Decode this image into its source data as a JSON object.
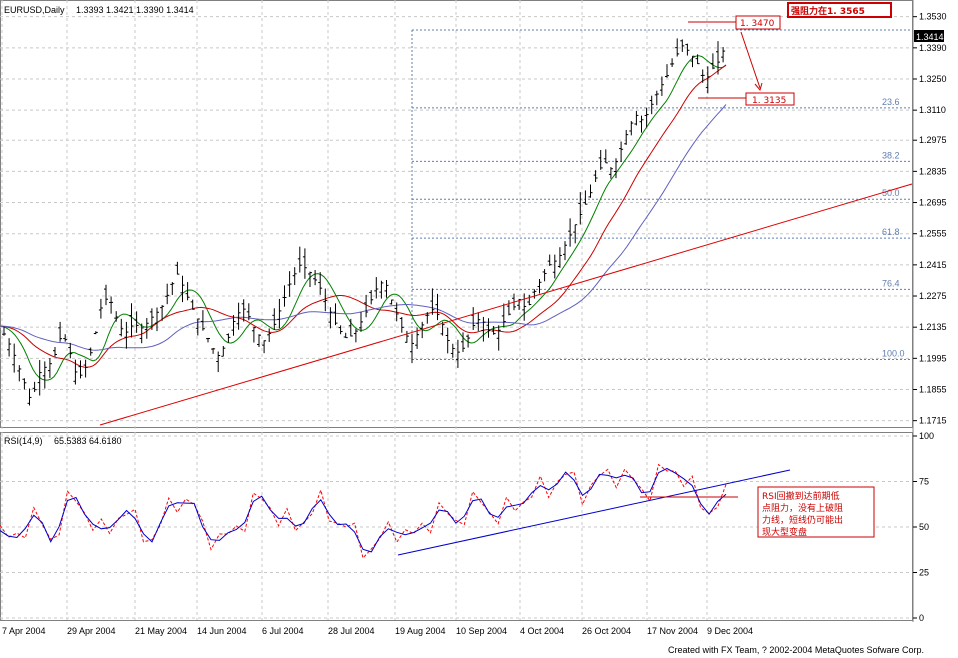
{
  "header": {
    "symbol": "EURUSD,Daily",
    "ohlc": "1.3393 1.3421 1.3390 1.3414",
    "rsi_label": "RSI(14,9)",
    "rsi_values": "65.5383  64.6180",
    "footer": "Created with FX Team, ? 2002-2004 MetaQuotes Sofware Corp."
  },
  "annotations": {
    "resistance_label": "强阻力在1. 3565",
    "high_label": "1. 3470",
    "target_label": "1. 3135",
    "current_price": "1.3414",
    "rsi_note": [
      "RSI回撤到达前期低",
      "点阻力，没有上破阻",
      "力线，短线仍可能出",
      "现大型变盘"
    ]
  },
  "colors": {
    "grid": "#c8c8c8",
    "candle": "#000000",
    "ma_fast": "#008000",
    "ma_mid": "#cc0000",
    "ma_slow": "#6060c0",
    "trendline": "#dd0000",
    "fib": "#5f7fb0",
    "rsi": "#0000cc",
    "rsi_signal": "#ff0000"
  },
  "chart_data": [
    {
      "type": "candlestick",
      "title": "EURUSD,Daily",
      "y_ticks": [
        "1.3530",
        "1.3390",
        "1.3250",
        "1.3110",
        "1.2975",
        "1.2835",
        "1.2695",
        "1.2555",
        "1.2415",
        "1.2275",
        "1.2135",
        "1.1995",
        "1.1855",
        "1.1715"
      ],
      "ylim": [
        1.17,
        1.356
      ],
      "x_tick_labels": [
        "7 Apr 2004",
        "29 Apr 2004",
        "21 May 2004",
        "14 Jun 2004",
        "6 Jul 2004",
        "28 Jul 2004",
        "19 Aug 2004",
        "10 Sep 2004",
        "4 Oct 2004",
        "26 Oct 2004",
        "17 Nov 2004",
        "9 Dec 2004"
      ],
      "close_path": [
        [
          0,
          1.214
        ],
        [
          8,
          1.203
        ],
        [
          15,
          1.19
        ],
        [
          20,
          1.18
        ],
        [
          26,
          1.194
        ],
        [
          34,
          1.198
        ],
        [
          40,
          1.211
        ],
        [
          44,
          1.205
        ],
        [
          50,
          1.19
        ],
        [
          55,
          1.195
        ],
        [
          60,
          1.205
        ],
        [
          65,
          1.222
        ],
        [
          70,
          1.228
        ],
        [
          75,
          1.218
        ],
        [
          80,
          1.21
        ],
        [
          86,
          1.215
        ],
        [
          92,
          1.213
        ],
        [
          98,
          1.218
        ],
        [
          104,
          1.222
        ],
        [
          110,
          1.231
        ],
        [
          114,
          1.238
        ],
        [
          118,
          1.232
        ],
        [
          124,
          1.222
        ],
        [
          130,
          1.214
        ],
        [
          136,
          1.206
        ],
        [
          140,
          1.2
        ],
        [
          146,
          1.206
        ],
        [
          152,
          1.219
        ],
        [
          158,
          1.222
        ],
        [
          164,
          1.213
        ],
        [
          170,
          1.207
        ],
        [
          176,
          1.213
        ],
        [
          182,
          1.224
        ],
        [
          188,
          1.235
        ],
        [
          194,
          1.242
        ],
        [
          200,
          1.238
        ],
        [
          206,
          1.232
        ],
        [
          212,
          1.222
        ],
        [
          218,
          1.213
        ],
        [
          224,
          1.208
        ],
        [
          230,
          1.212
        ],
        [
          236,
          1.22
        ],
        [
          242,
          1.23
        ],
        [
          248,
          1.235
        ],
        [
          254,
          1.223
        ],
        [
          260,
          1.212
        ],
        [
          266,
          1.206
        ],
        [
          272,
          1.214
        ],
        [
          278,
          1.222
        ],
        [
          284,
          1.218
        ],
        [
          290,
          1.205
        ],
        [
          296,
          1.202
        ],
        [
          300,
          1.205
        ],
        [
          305,
          1.214
        ],
        [
          310,
          1.218
        ],
        [
          315,
          1.212
        ],
        [
          320,
          1.21
        ],
        [
          325,
          1.216
        ],
        [
          330,
          1.221
        ],
        [
          335,
          1.226
        ],
        [
          340,
          1.221
        ],
        [
          345,
          1.23
        ],
        [
          350,
          1.236
        ],
        [
          355,
          1.242
        ],
        [
          360,
          1.244
        ],
        [
          365,
          1.251
        ],
        [
          370,
          1.258
        ],
        [
          375,
          1.265
        ],
        [
          380,
          1.272
        ],
        [
          385,
          1.282
        ],
        [
          390,
          1.288
        ],
        [
          395,
          1.284
        ],
        [
          400,
          1.292
        ],
        [
          405,
          1.302
        ],
        [
          410,
          1.309
        ],
        [
          415,
          1.306
        ],
        [
          420,
          1.313
        ],
        [
          425,
          1.32
        ],
        [
          430,
          1.326
        ],
        [
          435,
          1.334
        ],
        [
          440,
          1.34
        ],
        [
          445,
          1.337
        ],
        [
          450,
          1.332
        ],
        [
          455,
          1.324
        ],
        [
          460,
          1.33
        ],
        [
          465,
          1.334
        ],
        [
          468,
          1.341
        ]
      ],
      "fib_levels": [
        {
          "label": "23.6",
          "value": 1.312
        },
        {
          "label": "38.2",
          "value": 1.288
        },
        {
          "label": "50.0",
          "value": 1.271
        },
        {
          "label": "61.8",
          "value": 1.2535
        },
        {
          "label": "76.4",
          "value": 1.2305
        },
        {
          "label": "100.0",
          "value": 1.199
        }
      ],
      "high_marker": 1.347,
      "target_marker": 1.3135,
      "last_price": 1.3414
    },
    {
      "type": "line",
      "title": "RSI(14,9)",
      "y_ticks": [
        "100",
        "75",
        "50",
        "25",
        "0"
      ],
      "ylim": [
        0,
        100
      ],
      "series": [
        {
          "name": "RSI",
          "values": [
            48,
            42,
            45,
            52,
            55,
            50,
            44,
            52,
            62,
            65,
            60,
            52,
            46,
            50,
            57,
            58,
            52,
            48,
            44,
            50,
            60,
            66,
            64,
            60,
            50,
            46,
            42,
            44,
            50,
            55,
            62,
            65,
            62,
            56,
            52,
            50,
            55,
            60,
            62,
            58,
            54,
            50,
            45,
            40,
            38,
            42,
            48,
            50,
            46,
            44,
            50,
            55,
            58,
            56,
            54,
            58,
            62,
            64,
            60,
            56,
            58,
            62,
            66,
            68,
            70,
            72,
            76,
            78,
            74,
            70,
            72,
            76,
            78,
            80,
            78,
            74,
            70,
            72,
            78,
            80,
            82,
            78,
            70,
            62,
            60,
            64,
            65
          ]
        }
      ]
    }
  ]
}
